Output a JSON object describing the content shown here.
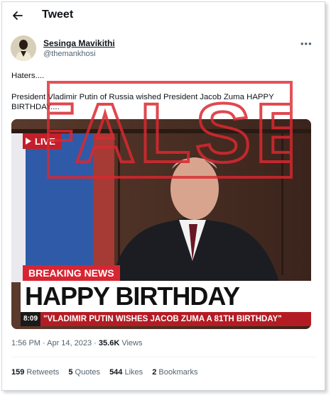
{
  "header": {
    "title": "Tweet",
    "back_icon": "arrow-left-icon"
  },
  "author": {
    "name": "Sesinga Mavikithi",
    "handle": "@themankhosi",
    "more_icon": "more-dots-icon"
  },
  "tweet": {
    "line1": "Haters....",
    "line2": "President Vladimir Putin of Russia wished President Jacob Zuma HAPPY BIRTHDAY...."
  },
  "stamp": {
    "text": "FALSE",
    "color": "#da2830"
  },
  "media": {
    "live_label": "LIVE",
    "breaking_label": "BREAKING NEWS",
    "headline": "HAPPY BIRTHDAY",
    "ticker_time": "8:09",
    "ticker_text": "\"VLADIMIR PUTIN WISHES JACOB ZUMA  A 81TH BIRTHDAY\""
  },
  "meta": {
    "time": "1:56 PM · Apr 14, 2023 · ",
    "views_count": "35.6K",
    "views_label": " Views"
  },
  "stats": [
    {
      "count": "159",
      "label": "Retweets"
    },
    {
      "count": "5",
      "label": "Quotes"
    },
    {
      "count": "544",
      "label": "Likes"
    },
    {
      "count": "2",
      "label": "Bookmarks"
    }
  ]
}
